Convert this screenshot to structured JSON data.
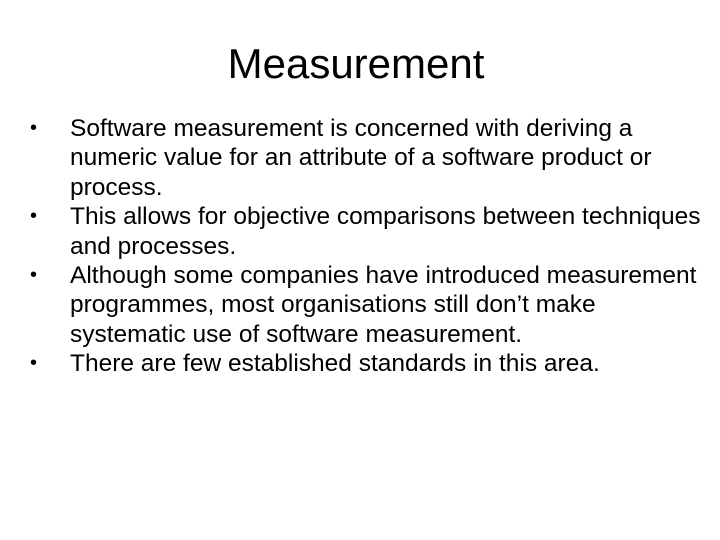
{
  "slide": {
    "title": "Measurement",
    "bullet_symbol": "•",
    "bullets": [
      "Software measurement is concerned with deriving a numeric value for an attribute of a software product or process.",
      "This allows for objective comparisons between techniques and processes.",
      "Although some companies have introduced measurement programmes, most organisations still don’t make systematic use of software measurement.",
      "There are few established standards in this area."
    ]
  }
}
